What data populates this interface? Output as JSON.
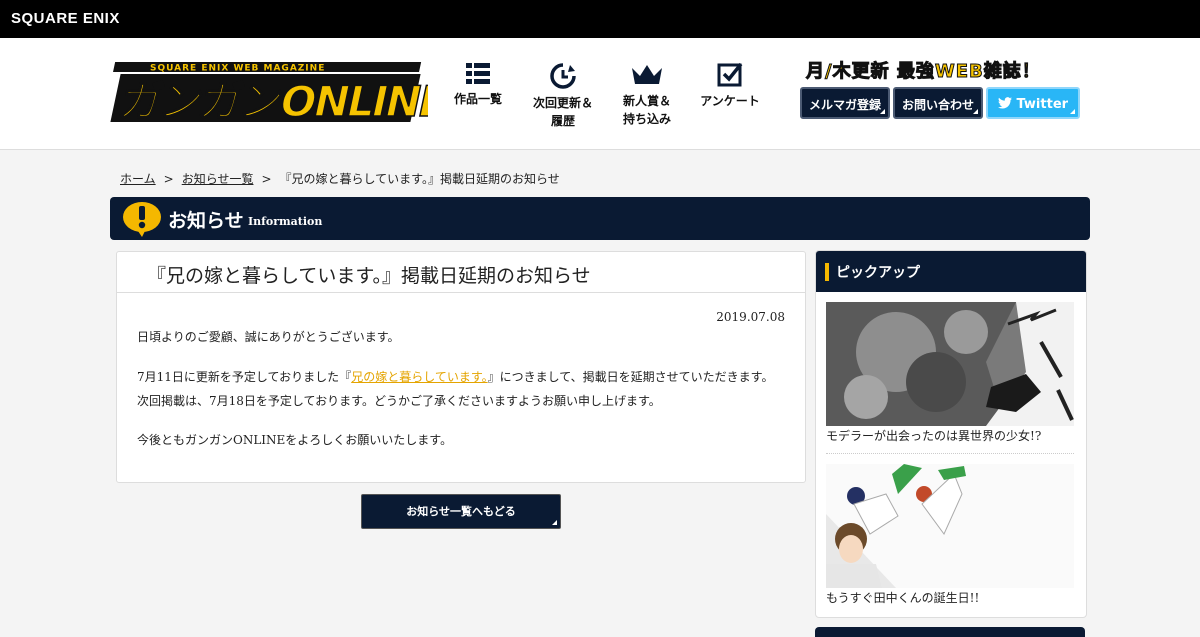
{
  "top_bar": {
    "brand": "SQUARE ENIX"
  },
  "header": {
    "logo_alt": "ガンガンONLINE SQUARE ENIX WEB MAGAZINE",
    "nav": [
      {
        "icon": "grid-icon",
        "label": "作品一覧"
      },
      {
        "icon": "update-clock-icon",
        "label": "次回更新＆",
        "label2": "履歴"
      },
      {
        "icon": "crown-icon",
        "label": "新人賞＆",
        "label2": "持ち込み"
      },
      {
        "icon": "checkbox-icon",
        "label": "アンケート"
      }
    ],
    "tagline": "月/木更新 最強WEB雑誌！",
    "buttons": {
      "newsletter": "メルマガ登録",
      "contact": "お問い合わせ",
      "twitter": "Twitter"
    },
    "colors": {
      "navy": "#0a1a33",
      "yellow": "#f5c300",
      "twitter": "#29b6f6"
    }
  },
  "breadcrumb": {
    "home": "ホーム",
    "sep": ">",
    "news": "お知らせ一覧",
    "current": "『兄の嫁と暮らしています。』掲載日延期のお知らせ"
  },
  "section": {
    "title": "お知らせ",
    "subtitle": "Information"
  },
  "article": {
    "title": "『兄の嫁と暮らしています。』掲載日延期のお知らせ",
    "date": "2019.07.08",
    "p1": "日頃よりのご愛顧、誠にありがとうございます。",
    "p2_before": "7月11日に更新を予定しておりました『",
    "p2_link": "兄の嫁と暮らしています。",
    "p2_after": "』につきまして、掲載日を延期させていただきます。",
    "p3": "次回掲載は、7月18日を予定しております。どうかご了承くださいますようお願い申し上げます。",
    "p4": "今後ともガンガンONLINEをよろしくお願いいたします。"
  },
  "back_button": "お知らせ一覧へもどる",
  "sidebar": {
    "title": "ピックアップ",
    "items": [
      {
        "caption": "モデラーが出会ったのは異世界の少女!?"
      },
      {
        "caption": "もうすぐ田中くんの誕生日!!"
      }
    ]
  }
}
